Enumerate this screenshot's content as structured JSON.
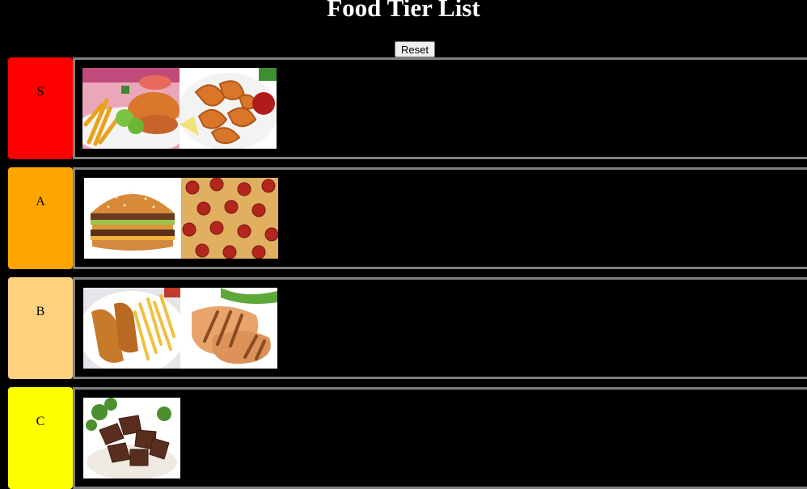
{
  "page": {
    "title": "Food Tier List",
    "reset_label": "Reset"
  },
  "tiers": [
    {
      "label": "S",
      "color": "#ff0000",
      "items": [
        "fish-and-chips",
        "fried-shrimp"
      ]
    },
    {
      "label": "A",
      "color": "#ffa500",
      "items": [
        "double-burger",
        "pepperoni-pizza"
      ]
    },
    {
      "label": "B",
      "color": "#ffd280",
      "items": [
        "chicken-tenders-fries",
        "grilled-chicken-breast"
      ]
    },
    {
      "label": "C",
      "color": "#ffff00",
      "items": [
        "beef-tips-rice"
      ]
    }
  ]
}
